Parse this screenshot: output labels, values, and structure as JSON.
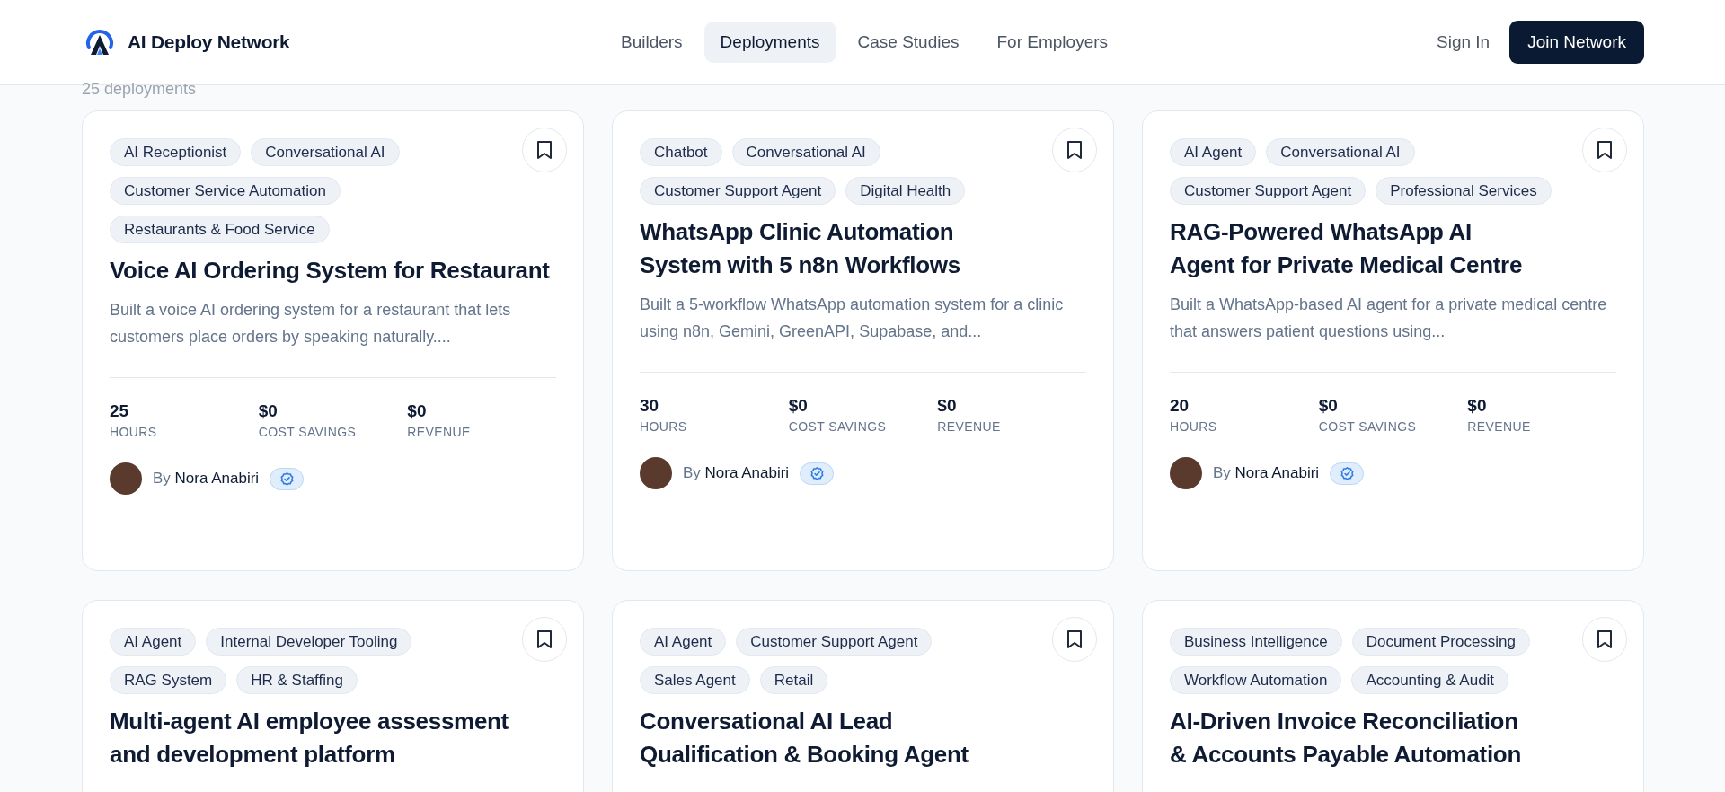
{
  "header": {
    "brand": "AI Deploy Network",
    "nav": [
      {
        "label": "Builders",
        "selected": false
      },
      {
        "label": "Deployments",
        "selected": true
      },
      {
        "label": "Case Studies",
        "selected": false
      },
      {
        "label": "For Employers",
        "selected": false
      }
    ],
    "sign_in": "Sign In",
    "join_button": "Join Network"
  },
  "count": "25 deployments",
  "cards": [
    {
      "tags": [
        "AI Receptionist",
        "Conversational AI",
        "Customer Service Automation",
        "Restaurants & Food Service"
      ],
      "bookmarked": false,
      "title": "Voice AI Ordering System for Restaurant",
      "description": "Built a voice AI ordering system for a restaurant that lets customers place orders by speaking naturally....",
      "stats": [
        {
          "value": "25",
          "label": "HOURS"
        },
        {
          "value": "$0",
          "label": "COST SAVINGS"
        },
        {
          "value": "$0",
          "label": "REVENUE"
        }
      ],
      "author": {
        "by": "By",
        "name": "Nora Anabiri",
        "verified": true
      }
    },
    {
      "tags": [
        "Chatbot",
        "Conversational AI",
        "Customer Support Agent",
        "Digital Health"
      ],
      "bookmarked": false,
      "title": "WhatsApp Clinic Automation System with 5 n8n Workflows",
      "description": "Built a 5-workflow WhatsApp automation system for a clinic using n8n, Gemini, GreenAPI, Supabase, and...",
      "stats": [
        {
          "value": "30",
          "label": "HOURS"
        },
        {
          "value": "$0",
          "label": "COST SAVINGS"
        },
        {
          "value": "$0",
          "label": "REVENUE"
        }
      ],
      "author": {
        "by": "By",
        "name": "Nora Anabiri",
        "verified": true
      }
    },
    {
      "tags": [
        "AI Agent",
        "Conversational AI",
        "Customer Support Agent",
        "Professional Services"
      ],
      "bookmarked": false,
      "title": "RAG-Powered WhatsApp AI Agent for Private Medical Centre",
      "description": "Built a WhatsApp-based AI agent for a private medical centre that answers patient questions using...",
      "stats": [
        {
          "value": "20",
          "label": "HOURS"
        },
        {
          "value": "$0",
          "label": "COST SAVINGS"
        },
        {
          "value": "$0",
          "label": "REVENUE"
        }
      ],
      "author": {
        "by": "By",
        "name": "Nora Anabiri",
        "verified": true
      }
    },
    {
      "tags": [
        "AI Agent",
        "Internal Developer Tooling",
        "RAG System",
        "HR & Staffing"
      ],
      "bookmarked": false,
      "title": "Multi-agent AI employee assessment and development platform"
    },
    {
      "tags": [
        "AI Agent",
        "Customer Support Agent",
        "Sales Agent",
        "Retail"
      ],
      "bookmarked": false,
      "title": "Conversational AI Lead Qualification & Booking Agent"
    },
    {
      "tags": [
        "Business Intelligence",
        "Document Processing",
        "Workflow Automation",
        "Accounting & Audit"
      ],
      "bookmarked": false,
      "title": "AI-Driven Invoice Reconciliation & Accounts Payable Automation"
    }
  ]
}
